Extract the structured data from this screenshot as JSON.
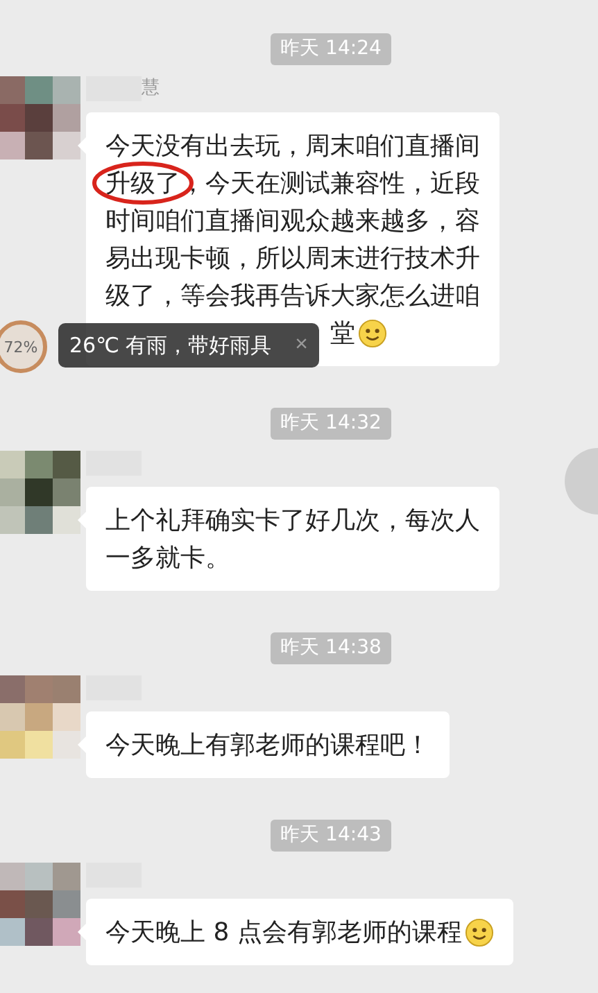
{
  "chat": [
    {
      "kind": "time",
      "text": "昨天 14:24"
    },
    {
      "kind": "message",
      "sender": "慧",
      "lines": [
        {
          "segments": [
            {
              "text": "今天没有出去玩，周末咱们直播间",
              "circled": false
            }
          ]
        },
        {
          "segments": [
            {
              "text": "升级了",
              "circled": true
            },
            {
              "text": "，今天在测试兼容性，近段",
              "circled": false
            }
          ]
        },
        {
          "segments": [
            {
              "text": "时间咱们直播间观众越来越多，容",
              "circled": false
            }
          ]
        },
        {
          "segments": [
            {
              "text": "易出现卡顿，所以周末进行技术升",
              "circled": false
            }
          ]
        },
        {
          "segments": [
            {
              "text": "级了，等会我再告诉大家怎么进咱",
              "circled": false
            }
          ]
        },
        {
          "segments": [
            {
              "text": "堂",
              "circled": false
            }
          ],
          "behind_toast": true
        }
      ],
      "emoji": true
    },
    {
      "kind": "time",
      "text": "昨天 14:32"
    },
    {
      "kind": "message",
      "lines": [
        {
          "segments": [
            {
              "text": "上个礼拜确实卡了好几次，每次人",
              "circled": false
            }
          ]
        },
        {
          "segments": [
            {
              "text": "一多就卡。",
              "circled": false
            }
          ]
        }
      ],
      "emoji": false
    },
    {
      "kind": "time",
      "text": "昨天 14:38"
    },
    {
      "kind": "message",
      "lines": [
        {
          "segments": [
            {
              "text": "今天晚上有郭老师的课程吧！",
              "circled": false
            }
          ]
        }
      ],
      "emoji": false
    },
    {
      "kind": "time",
      "text": "昨天 14:43"
    },
    {
      "kind": "message",
      "lines": [
        {
          "segments": [
            {
              "text": "今天晚上 8 点会有郭老师的课程",
              "circled": false
            }
          ]
        }
      ],
      "emoji": true
    }
  ],
  "weather_toast": {
    "text": "26℃ 有雨，带好雨具",
    "close": "×"
  },
  "battery_badge": {
    "text": "72%"
  }
}
